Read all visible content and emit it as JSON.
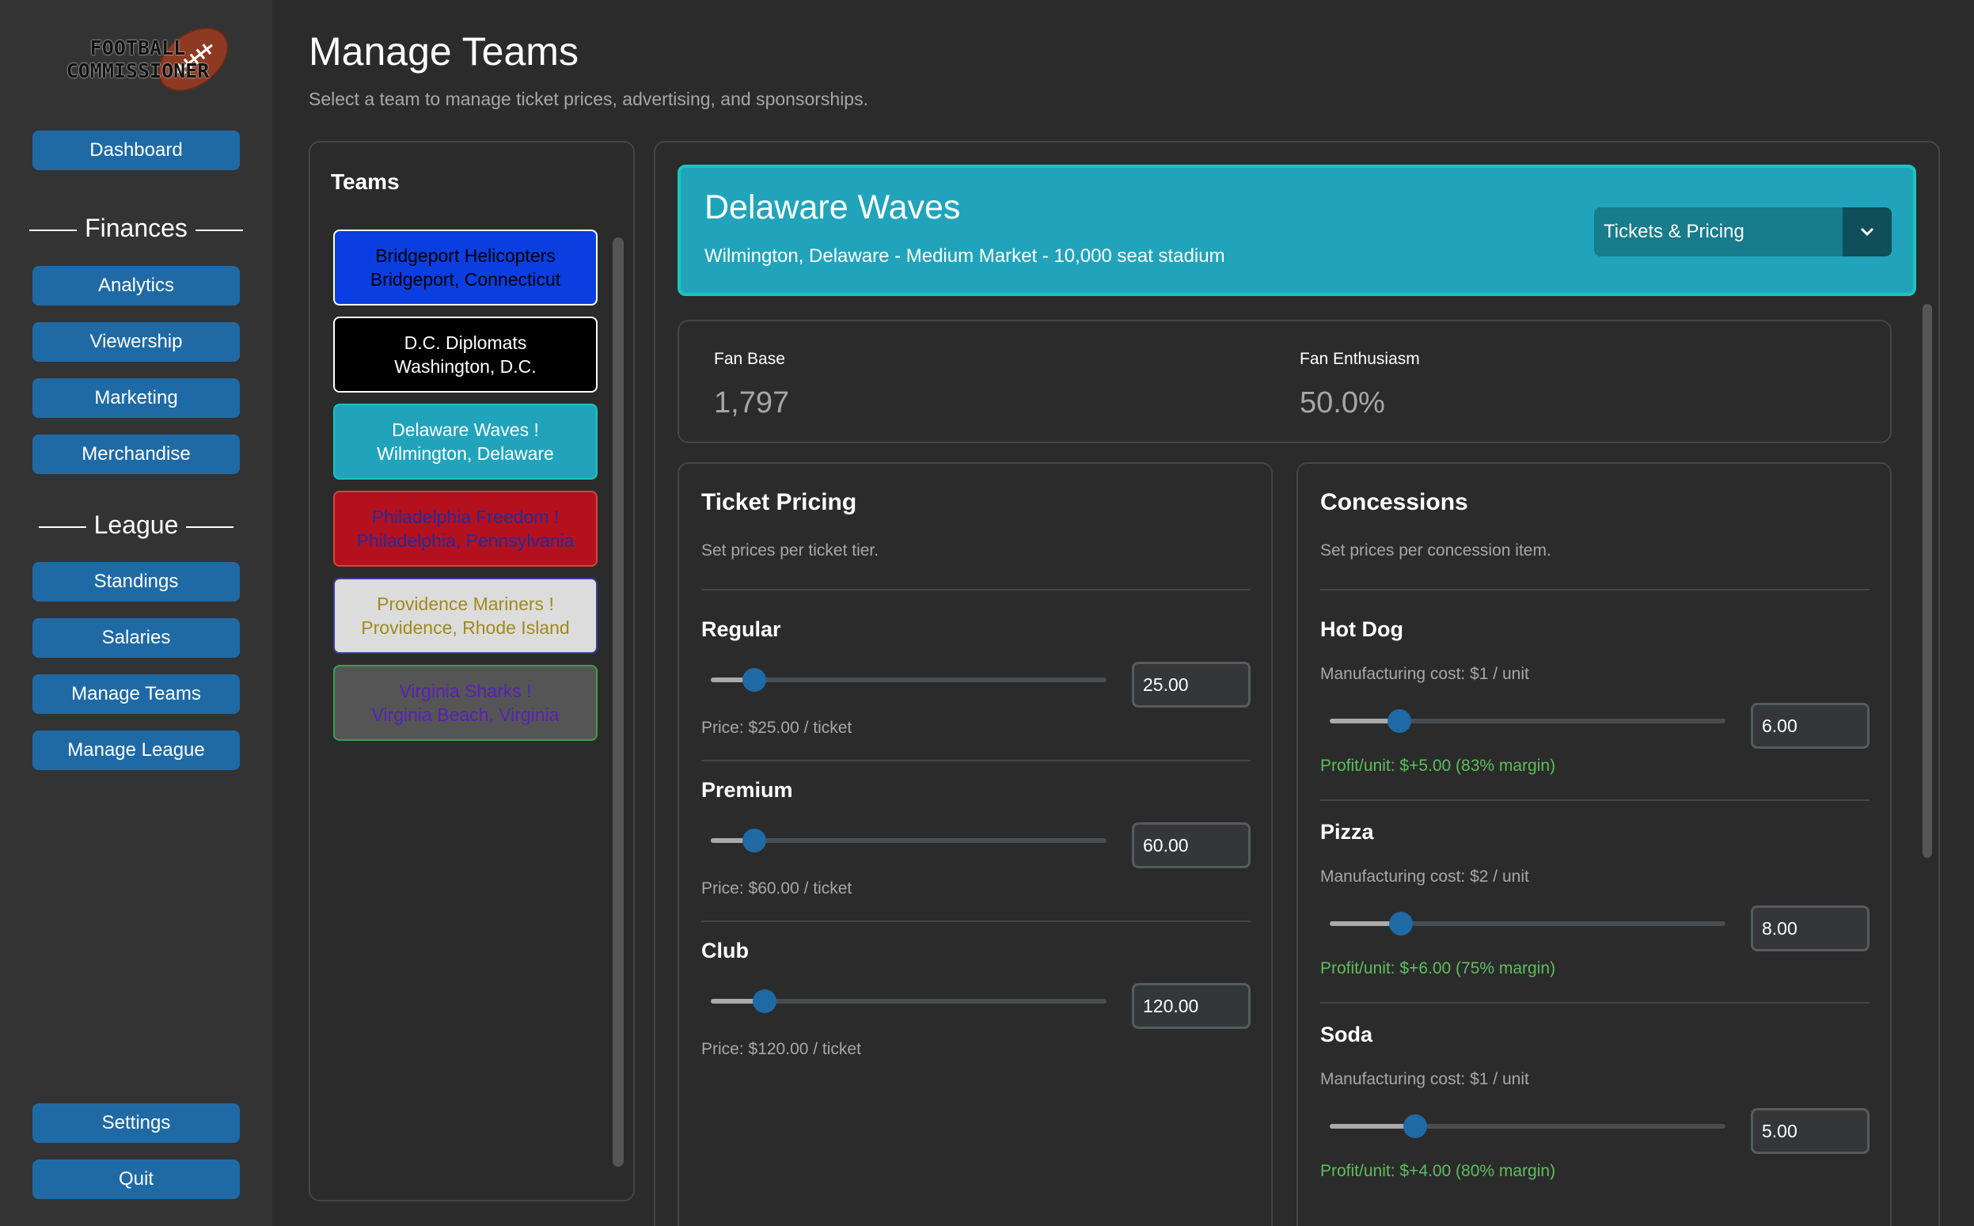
{
  "app": {
    "logo_text_line1": "FOOTBALL",
    "logo_text_line2": "COMMISSIONER"
  },
  "sidebar": {
    "dashboard_label": "Dashboard",
    "finances_heading": "Finances",
    "finances_items": [
      "Analytics",
      "Viewership",
      "Marketing",
      "Merchandise"
    ],
    "league_heading": "League",
    "league_items": [
      "Standings",
      "Salaries",
      "Manage Teams",
      "Manage League"
    ],
    "settings_label": "Settings",
    "quit_label": "Quit",
    "button_color": "#1f6aa5"
  },
  "header": {
    "title": "Manage Teams",
    "subtitle": "Select a team to manage ticket prices, advertising, and sponsorships."
  },
  "teams": {
    "title": "Teams",
    "list": [
      {
        "name": "Bridgeport Helicopters",
        "location": "Bridgeport, Connecticut",
        "bg": "#0a3ee0",
        "fg": "#000000",
        "border": "#ffffff"
      },
      {
        "name": "D.C. Diplomats",
        "location": "Washington, D.C.",
        "bg": "#000000",
        "fg": "#ffffff",
        "border": "#ffffff"
      },
      {
        "name": "Delaware Waves  !",
        "location": "Wilmington, Delaware",
        "bg": "#21a4bb",
        "fg": "#ffffff",
        "border": "#1cc4bd"
      },
      {
        "name": "Philadelphia Freedom  !",
        "location": "Philadelphia, Pennsylvania",
        "bg": "#b5101e",
        "fg": "#1c2fa0",
        "border": "#d14545"
      },
      {
        "name": "Providence Mariners  !",
        "location": "Providence, Rhode Island",
        "bg": "#dcdcdc",
        "fg": "#a08a1c",
        "border": "#3d3d9e"
      },
      {
        "name": "Virginia Sharks  !",
        "location": "Virginia Beach, Virginia",
        "bg": "#555555",
        "fg": "#5a20b8",
        "border": "#3aa04a"
      }
    ]
  },
  "selected_team": {
    "name": "Delaware Waves",
    "meta": "Wilmington, Delaware - Medium Market - 10,000 seat stadium",
    "color": "#21a4bb",
    "view_select": "Tickets & Pricing"
  },
  "stats": {
    "fan_base_label": "Fan Base",
    "fan_base_value": "1,797",
    "fan_enthusiasm_label": "Fan Enthusiasm",
    "fan_enthusiasm_value": "50.0%"
  },
  "ticket_pricing": {
    "title": "Ticket Pricing",
    "subtitle": "Set prices per ticket tier.",
    "tiers": [
      {
        "label": "Regular",
        "value": "25.00",
        "note": "Price: $25.00 / ticket",
        "slider_fraction": 0.11
      },
      {
        "label": "Premium",
        "value": "60.00",
        "note": "Price: $60.00 / ticket",
        "slider_fraction": 0.11
      },
      {
        "label": "Club",
        "value": "120.00",
        "note": "Price: $120.00 / ticket",
        "slider_fraction": 0.135
      }
    ]
  },
  "concessions": {
    "title": "Concessions",
    "subtitle": "Set prices per concession item.",
    "items": [
      {
        "label": "Hot Dog",
        "cost": "Manufacturing cost: $1 / unit",
        "value": "6.00",
        "profit": "Profit/unit: $+5.00  (83% margin)",
        "slider_fraction": 0.175
      },
      {
        "label": "Pizza",
        "cost": "Manufacturing cost: $2 / unit",
        "value": "8.00",
        "profit": "Profit/unit: $+6.00  (75% margin)",
        "slider_fraction": 0.18
      },
      {
        "label": "Soda",
        "cost": "Manufacturing cost: $1 / unit",
        "value": "5.00",
        "profit": "Profit/unit: $+4.00  (80% margin)",
        "slider_fraction": 0.215
      }
    ]
  }
}
